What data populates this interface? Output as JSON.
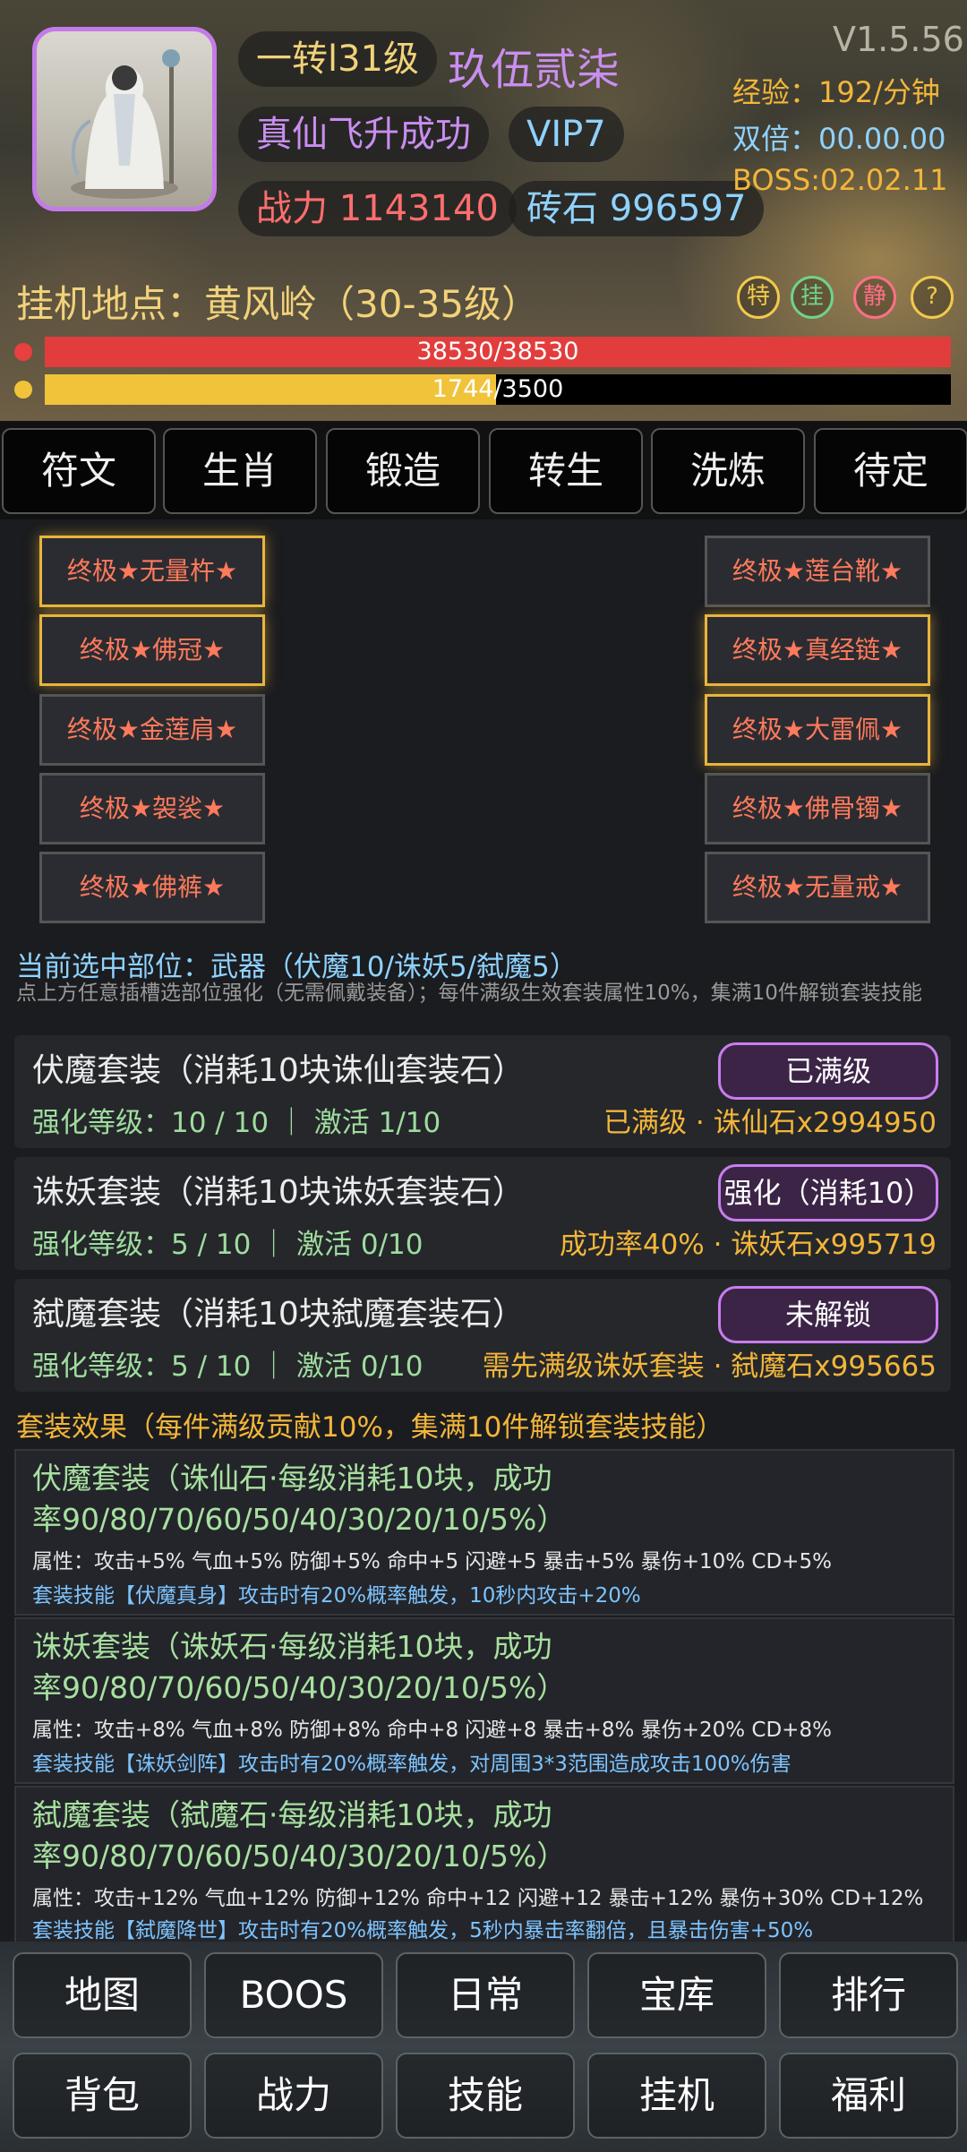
{
  "header": {
    "rebirth_level": "一转l31级",
    "player_name": "玖伍贰柒",
    "status": "真仙飞升成功",
    "vip": "VIP7",
    "power": "战力 1143140",
    "bricks": "砖石 996597",
    "version": "V1.5.56",
    "exp": "经验：192/分钟",
    "double": "双倍：00.00.00",
    "boss": "BOSS:02.02.11",
    "location": "挂机地点：黄风岭（30-35级）",
    "icons": [
      {
        "label": "特",
        "color": "#f2c94c"
      },
      {
        "label": "挂",
        "color": "#6fd38a"
      },
      {
        "label": "静",
        "color": "#ff6e8a"
      },
      {
        "label": "?",
        "color": "#f2c94c"
      }
    ],
    "hp_text": "38530/38530",
    "hp_fraction": 1.0,
    "exp_text": "1744/3500",
    "exp_fraction": 0.498
  },
  "tabs": [
    "符文",
    "生肖",
    "锻造",
    "转生",
    "洗炼",
    "待定"
  ],
  "slots_left": [
    "终极★无量杵★",
    "终极★佛冠★",
    "终极★金莲肩★",
    "终极★袈裟★",
    "终极★佛裤★"
  ],
  "slots_right": [
    "终极★莲台靴★",
    "终极★真经链★",
    "终极★大雷佩★",
    "终极★佛骨镯★",
    "终极★无量戒★"
  ],
  "selected": {
    "title": "当前选中部位：武器（伏魔10/诛妖5/弑魔5）",
    "hint": "点上方任意插槽选部位强化（无需佩戴装备）；每件满级生效套装属性10%，集满10件解锁套装技能"
  },
  "sets": [
    {
      "title": "伏魔套装（消耗10块诛仙套装石）",
      "level": "强化等级：10 / 10 ｜ 激活 1/10",
      "right": "已满级 · 诛仙石x2994950",
      "button": "已满级"
    },
    {
      "title": "诛妖套装（消耗10块诛妖套装石）",
      "level": "强化等级：5 / 10 ｜ 激活 0/10",
      "right": "成功率40% · 诛妖石x995719",
      "button": "强化（消耗10）"
    },
    {
      "title": "弑魔套装（消耗10块弑魔套装石）",
      "level": "强化等级：5 / 10 ｜ 激活 0/10",
      "right": "需先满级诛妖套装 · 弑魔石x995665",
      "button": "未解锁"
    }
  ],
  "effects_title": "套装效果（每件满级贡献10%，集满10件解锁套装技能）",
  "effects": [
    {
      "name": "伏魔套装（诛仙石·每级消耗10块，成功率90/80/70/60/50/40/30/20/10/5%）",
      "attr": "属性：攻击+5% 气血+5% 防御+5% 命中+5 闪避+5 暴击+5% 暴伤+10% CD+5%",
      "skill": "套装技能【伏魔真身】攻击时有20%概率触发，10秒内攻击+20%"
    },
    {
      "name": "诛妖套装（诛妖石·每级消耗10块，成功率90/80/70/60/50/40/30/20/10/5%）",
      "attr": "属性：攻击+8% 气血+8% 防御+8% 命中+8 闪避+8 暴击+8% 暴伤+20% CD+8%",
      "skill": "套装技能【诛妖剑阵】攻击时有20%概率触发，对周围3*3范围造成攻击100%伤害"
    },
    {
      "name": "弑魔套装（弑魔石·每级消耗10块，成功率90/80/70/60/50/40/30/20/10/5%）",
      "attr": "属性：攻击+12% 气血+12% 防御+12% 命中+12 闪避+12 暴击+12% 暴伤+30% CD+12%",
      "skill": "套装技能【弑魔降世】攻击时有20%概率触发，5秒内暴击率翻倍，且暴击伤害+50%"
    }
  ],
  "bottom_nav_row1": [
    "地图",
    "BOOS",
    "日常",
    "宝库",
    "排行"
  ],
  "bottom_nav_row2": [
    "背包",
    "战力",
    "技能",
    "挂机",
    "福利"
  ]
}
